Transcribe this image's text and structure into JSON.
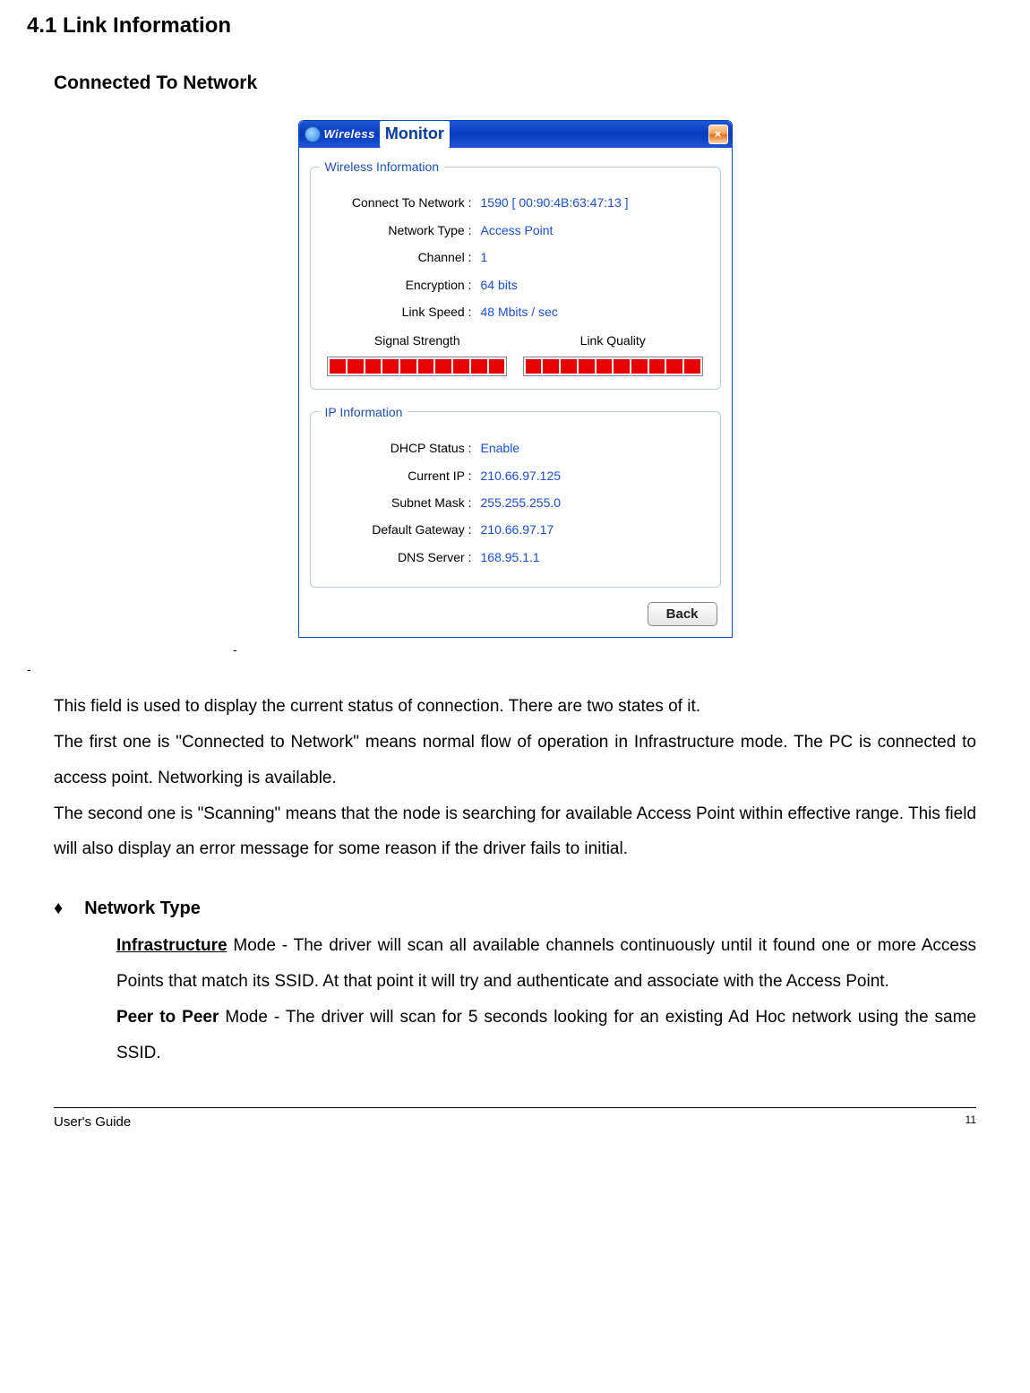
{
  "headings": {
    "h1": "4.1 Link Information",
    "h2": "Connected To Network"
  },
  "app": {
    "title_wireless": "Wireless",
    "title_monitor": "Monitor",
    "close_glyph": "×",
    "wireless_legend": "Wireless Information",
    "ip_legend": "IP Information",
    "back_label": "Back",
    "wireless": {
      "connect_label": "Connect To Network :",
      "connect_value": "1590 [ 00:90:4B:63:47:13 ]",
      "nettype_label": "Network Type :",
      "nettype_value": "Access Point",
      "channel_label": "Channel :",
      "channel_value": "1",
      "encryption_label": "Encryption :",
      "encryption_value": "64 bits",
      "linkspeed_label": "Link Speed :",
      "linkspeed_value": "48 Mbits / sec",
      "signal_label": "Signal Strength",
      "quality_label": "Link Quality"
    },
    "ip": {
      "dhcp_label": "DHCP Status :",
      "dhcp_value": "Enable",
      "ip_label": "Current IP :",
      "ip_value": "210.66.97.125",
      "mask_label": "Subnet Mask :",
      "mask_value": "255.255.255.0",
      "gateway_label": "Default Gateway :",
      "gateway_value": "210.66.97.17",
      "dns_label": "DNS Server :",
      "dns_value": "168.95.1.1"
    }
  },
  "para": {
    "p1": "This field is used to display the current status of connection. There are two states of it.",
    "p2": "The first one is \"Connected to Network\" means normal flow of operation in Infrastructure mode. The PC is connected to access point.  Networking is available.",
    "p3": "The second one is \"Scanning\" means that the node is searching for available Access Point within effective range. This field will also display an error message for some reason if the driver fails to initial."
  },
  "bullet": {
    "mark": "♦",
    "heading": "Network Type",
    "infra_runin": "Infrastructure",
    "infra_rest": " Mode    - The driver will scan all available channels continuously until it found one or more Access Points that match its SSID.  At that point it will try and authenticate and associate with the Access Point.",
    "peer_runin": " Peer to Peer",
    "peer_rest": " Mode  - The driver will scan for 5 seconds looking for an existing Ad Hoc network using the same SSID."
  },
  "dashes": {
    "under_image": "-",
    "left": "-"
  },
  "footer": {
    "guide": "User's Guide",
    "page": "11"
  }
}
